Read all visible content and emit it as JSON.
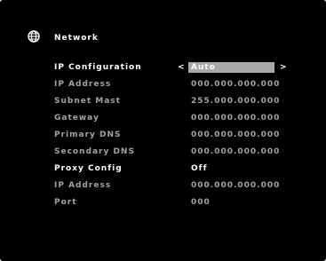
{
  "menu": {
    "title": "Network",
    "icon": "globe-icon"
  },
  "settings": {
    "ip_configuration": {
      "label": "IP Configuration",
      "value": "Auto",
      "prev_arrow": "<",
      "next_arrow": ">"
    },
    "ip_address": {
      "label": "IP Address",
      "value": "000.000.000.000"
    },
    "subnet_mask": {
      "label": "Subnet Mast",
      "value": "255.000.000.000"
    },
    "gateway": {
      "label": "Gateway",
      "value": "000.000.000.000"
    },
    "primary_dns": {
      "label": "Primary DNS",
      "value": "000.000.000.000"
    },
    "secondary_dns": {
      "label": "Secondary DNS",
      "value": "000.000.000.000"
    },
    "proxy_config": {
      "label": "Proxy Config",
      "value": "Off"
    },
    "proxy_ip_address": {
      "label": "IP Address",
      "value": "000.000.000.000"
    },
    "port": {
      "label": "Port",
      "value": "000"
    }
  },
  "colors": {
    "background": "#000000",
    "active_text": "#ffffff",
    "inactive_text": "#a3a3a3",
    "selection_highlight": "#a8a8a8"
  }
}
